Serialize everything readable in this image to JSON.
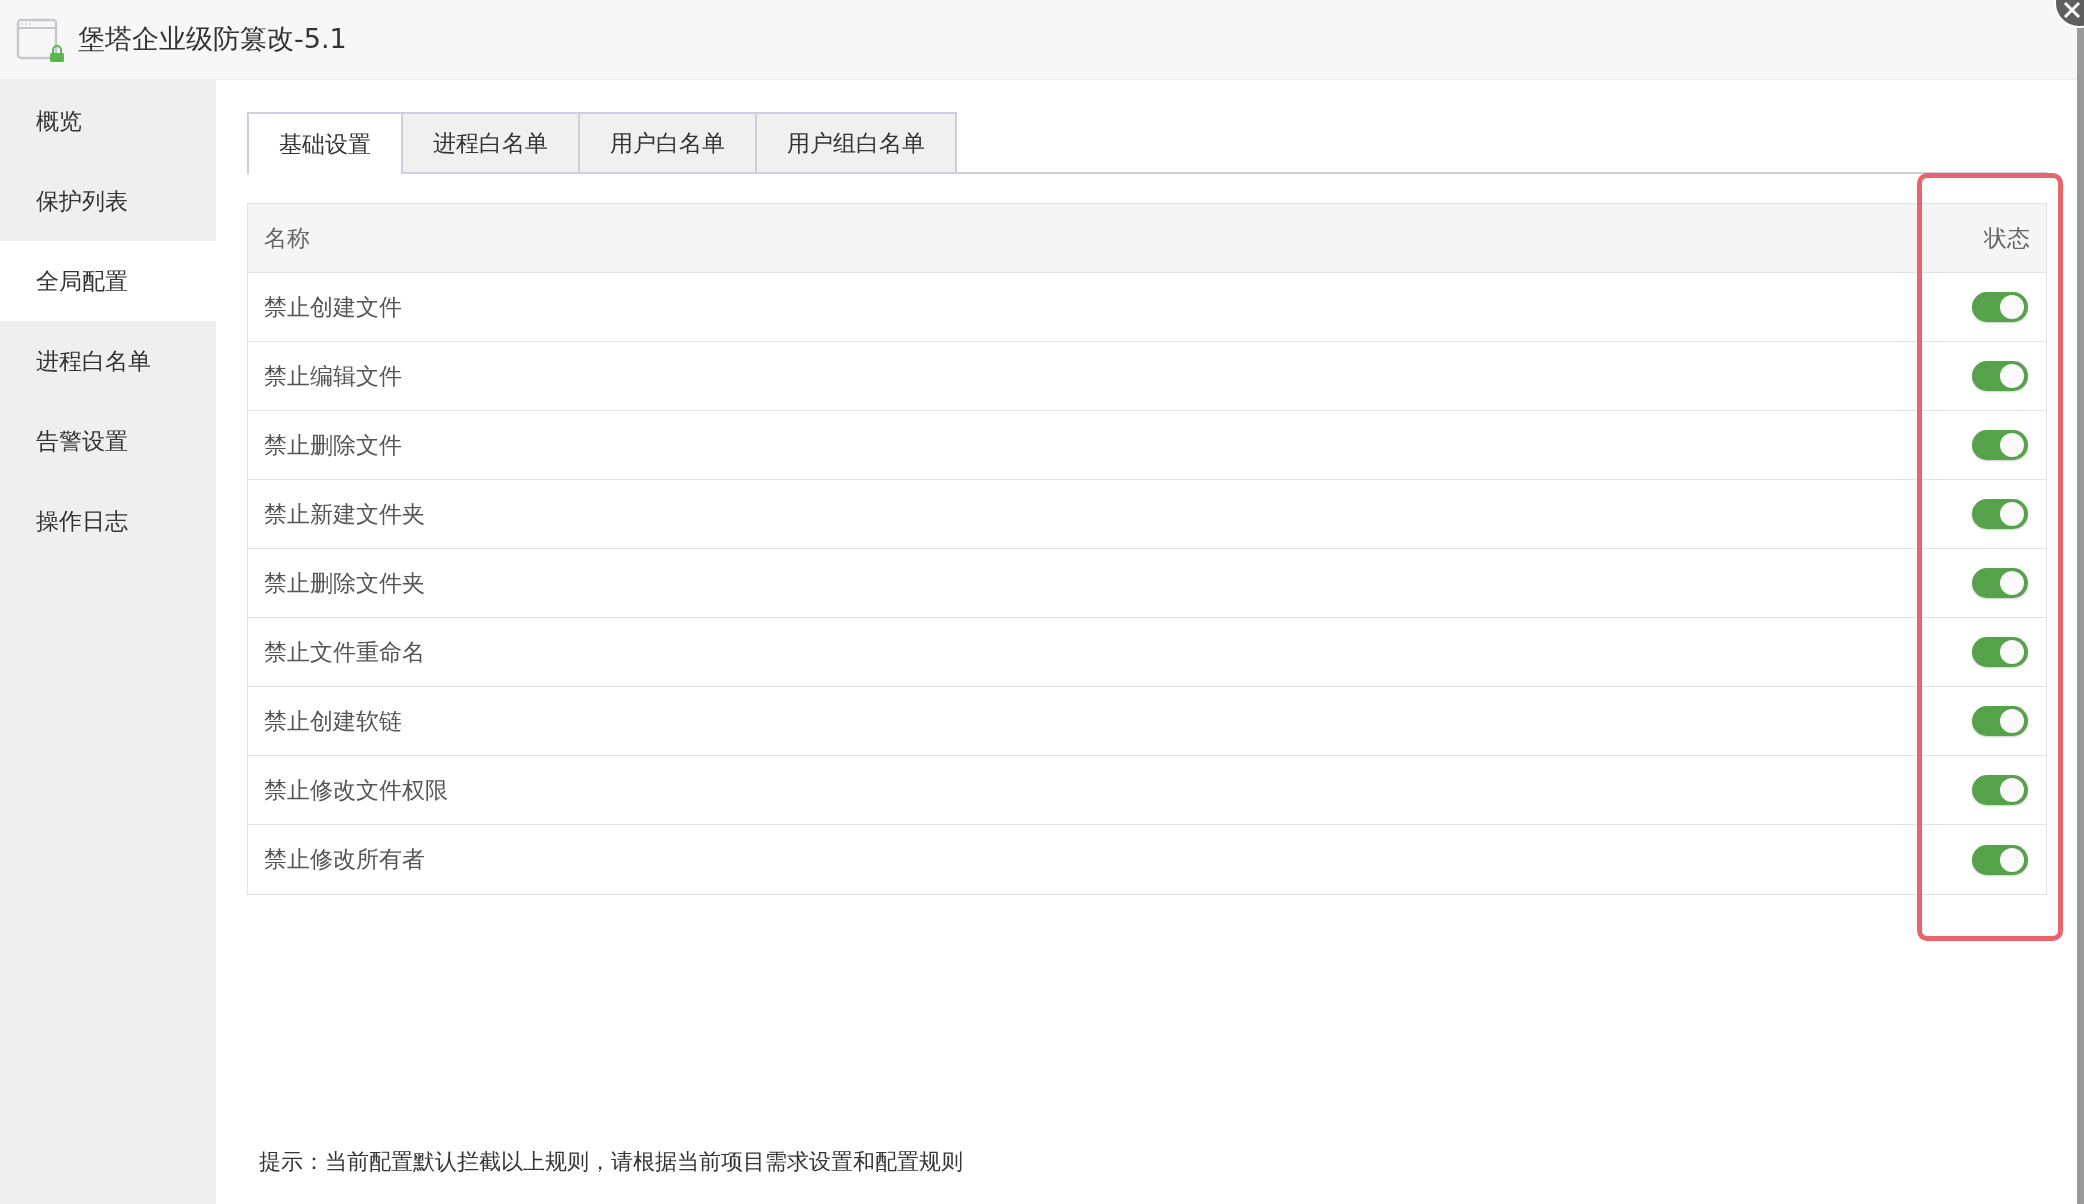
{
  "window": {
    "title": "堡塔企业级防篡改-5.1"
  },
  "sidebar": {
    "items": [
      {
        "label": "概览",
        "selected": false
      },
      {
        "label": "保护列表",
        "selected": false
      },
      {
        "label": "全局配置",
        "selected": true
      },
      {
        "label": "进程白名单",
        "selected": false
      },
      {
        "label": "告警设置",
        "selected": false
      },
      {
        "label": "操作日志",
        "selected": false
      }
    ]
  },
  "tabs": [
    {
      "label": "基础设置",
      "selected": true
    },
    {
      "label": "进程白名单",
      "selected": false
    },
    {
      "label": "用户白名单",
      "selected": false
    },
    {
      "label": "用户组白名单",
      "selected": false
    }
  ],
  "table": {
    "columns": [
      "名称",
      "状态"
    ],
    "rows": [
      {
        "name": "禁止创建文件",
        "on": true
      },
      {
        "name": "禁止编辑文件",
        "on": true
      },
      {
        "name": "禁止删除文件",
        "on": true
      },
      {
        "name": "禁止新建文件夹",
        "on": true
      },
      {
        "name": "禁止删除文件夹",
        "on": true
      },
      {
        "name": "禁止文件重命名",
        "on": true
      },
      {
        "name": "禁止创建软链",
        "on": true
      },
      {
        "name": "禁止修改文件权限",
        "on": true
      },
      {
        "name": "禁止修改所有者",
        "on": true
      }
    ]
  },
  "hint": "提示：当前配置默认拦截以上规则，请根据当前项目需求设置和配置规则"
}
